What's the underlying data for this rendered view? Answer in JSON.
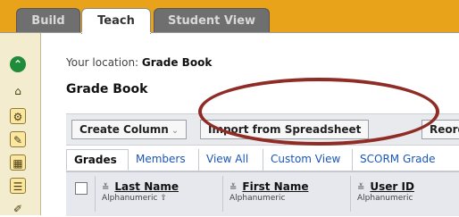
{
  "top_tabs": [
    {
      "label": "Build",
      "active": false
    },
    {
      "label": "Teach",
      "active": true
    },
    {
      "label": "Student View",
      "active": false
    }
  ],
  "location": {
    "prefix": "Your location: ",
    "value": "Grade Book"
  },
  "page_title": "Grade Book",
  "toolbar": {
    "create_column": "Create Column",
    "import_spreadsheet": "Import from Spreadsheet",
    "reorder": "Reord"
  },
  "sub_tabs": [
    "Grades",
    "Members",
    "View All",
    "Custom View",
    "SCORM Grade"
  ],
  "columns": [
    {
      "title": "Last Name",
      "sort_type": "Alphanumeric",
      "sort_arrow": "⇧"
    },
    {
      "title": "First Name",
      "sort_type": "Alphanumeric"
    },
    {
      "title": "User ID",
      "sort_type": "Alphanumeric"
    }
  ],
  "rail_icons": [
    "collapse-up-icon",
    "home-icon",
    "tools-icon",
    "edit-icon",
    "calendar-icon",
    "chat-icon",
    "pencil-icon"
  ],
  "colors": {
    "top_bar": "#e8a31a",
    "rail": "#f4eccf",
    "highlight_circle": "#8e2c25",
    "link": "#1a56b8"
  }
}
